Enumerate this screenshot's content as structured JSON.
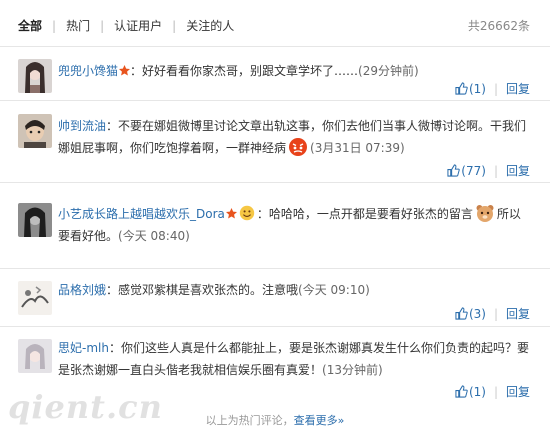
{
  "tabs": {
    "items": [
      "全部",
      "热门",
      "认证用户",
      "关注的人"
    ],
    "total": "共26662条"
  },
  "comments": [
    {
      "user": "兜兜小馋猫",
      "text": "：好好看看你家杰哥，别跟文章学坏了……",
      "time": "(29分钟前)",
      "likes": "(1)",
      "reply": "回复"
    },
    {
      "user": "帅到流油",
      "text": "：不要在娜姐微博里讨论文章出轨这事，你们去他们当事人微博讨论啊。干我们娜姐屁事啊，你们吃饱撑着啊，一群神经病",
      "time": "(3月31日 07:39)",
      "likes": "(77)",
      "reply": "回复"
    },
    {
      "user": "小艺成长路上越唱越欢乐_Dora",
      "text_a": "：",
      "text_b": "哈哈哈，一点开都是要看好张杰的留言",
      "text_c": "所以要看好他。",
      "time": "(今天 08:40)"
    },
    {
      "user": "品格刘娥",
      "text": "：感觉邓紫棋是喜欢张杰的。注意哦",
      "time": "(今天 09:10)",
      "likes": "(3)",
      "reply": "回复"
    },
    {
      "user": "思妃-mlh",
      "text": "：你们这些人真是什么都能扯上，要是张杰谢娜真发生什么你们负责的起吗？要是张杰谢娜一直白头偕老我就相信娱乐圈有真爱！",
      "time": "(13分钟前)",
      "likes": "(1)",
      "reply": "回复"
    }
  ],
  "footer": {
    "text": "以上为热门评论，",
    "more": "查看更多»"
  },
  "watermark": "qient.cn",
  "colors": {
    "link": "#2c6eac",
    "medal": "#e8541e"
  },
  "icons": [
    "thumb-up-icon",
    "medal-icon",
    "angry-emoticon",
    "smile-emoticon",
    "bear-emoticon"
  ]
}
